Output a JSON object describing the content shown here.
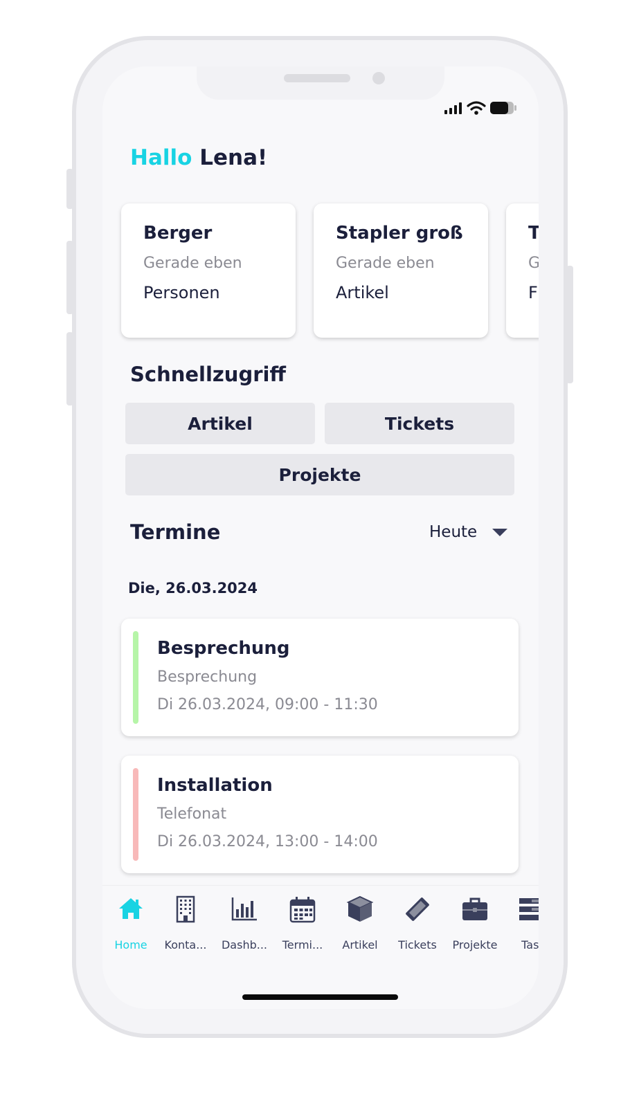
{
  "greeting": {
    "prefix": "Hallo",
    "name": "Lena!"
  },
  "recent_cards": [
    {
      "title": "Berger",
      "time": "Gerade eben",
      "category": "Personen"
    },
    {
      "title": "Stapler groß",
      "time": "Gerade eben",
      "category": "Artikel"
    },
    {
      "title": "T",
      "time": "G",
      "category": "F"
    }
  ],
  "quick_access": {
    "title": "Schnellzugriff",
    "buttons": [
      "Artikel",
      "Tickets",
      "Projekte"
    ]
  },
  "appointments": {
    "title": "Termine",
    "filter": "Heute",
    "date": "Die, 26.03.2024",
    "items": [
      {
        "title": "Besprechung",
        "type": "Besprechung",
        "when": "Di 26.03.2024, 09:00 - 11:30",
        "color": "#b6f5a8"
      },
      {
        "title": "Installation",
        "type": "Telefonat",
        "when": "Di 26.03.2024, 13:00 - 14:00",
        "color": "#f8b9b9"
      }
    ]
  },
  "tabs": [
    {
      "label": "Home",
      "icon": "home-icon"
    },
    {
      "label": "Konta...",
      "icon": "building-icon"
    },
    {
      "label": "Dashb...",
      "icon": "bar-chart-icon"
    },
    {
      "label": "Termi...",
      "icon": "calendar-icon"
    },
    {
      "label": "Artikel",
      "icon": "box-icon"
    },
    {
      "label": "Tickets",
      "icon": "ticket-icon"
    },
    {
      "label": "Projekte",
      "icon": "briefcase-icon"
    },
    {
      "label": "Tasl",
      "icon": "tasks-icon"
    }
  ],
  "colors": {
    "accent": "#18d3e3",
    "text": "#1b1f3b",
    "muted": "#8a8a92",
    "button_bg": "#e8e8ec"
  }
}
